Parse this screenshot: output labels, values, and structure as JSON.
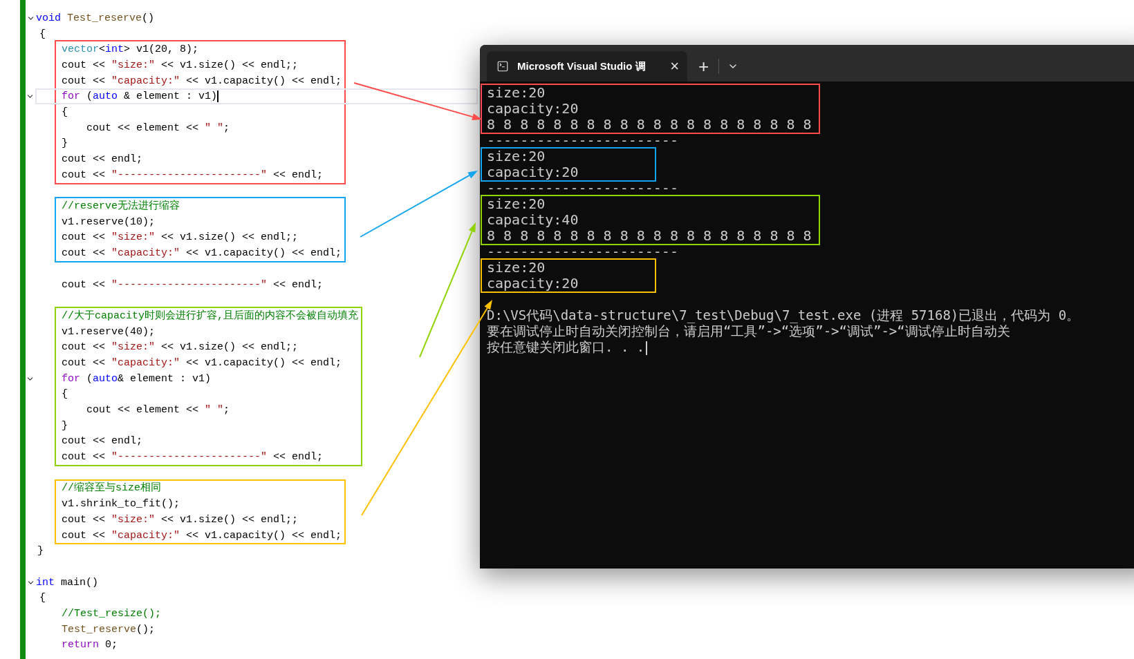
{
  "editor": {
    "functions": [
      {
        "header": {
          "expanded": true,
          "segments": [
            {
              "kind": "keyword",
              "text": "void"
            },
            {
              "kind": "function",
              "text": " Test_reserve"
            },
            {
              "kind": "plain",
              "text": "()"
            }
          ]
        },
        "open": "{",
        "blocks": [
          {
            "kind": "box",
            "color": "#ff4b4b",
            "lines": [
              {
                "segments": [
                  {
                    "kind": "type",
                    "text": "vector"
                  },
                  {
                    "kind": "plain",
                    "text": "<"
                  },
                  {
                    "kind": "keyword",
                    "text": "int"
                  },
                  {
                    "kind": "plain",
                    "text": "> v1(20, 8);"
                  }
                ]
              },
              {
                "segments": [
                  {
                    "kind": "plain",
                    "text": "cout << "
                  },
                  {
                    "kind": "string",
                    "text": "\"size:\""
                  },
                  {
                    "kind": "plain",
                    "text": " << v1.size() << endl;;"
                  }
                ]
              },
              {
                "segments": [
                  {
                    "kind": "plain",
                    "text": "cout << "
                  },
                  {
                    "kind": "string",
                    "text": "\"capacity:\""
                  },
                  {
                    "kind": "plain",
                    "text": " << v1.capacity() << endl;"
                  }
                ]
              },
              {
                "expanded": true,
                "current": true,
                "segments": [
                  {
                    "kind": "control",
                    "text": "for"
                  },
                  {
                    "kind": "plain",
                    "text": " ("
                  },
                  {
                    "kind": "keyword",
                    "text": "auto"
                  },
                  {
                    "kind": "plain",
                    "text": " & element : v1)"
                  }
                ]
              },
              {
                "segments": [
                  {
                    "kind": "plain",
                    "text": "{"
                  }
                ]
              },
              {
                "segments": [
                  {
                    "kind": "plain",
                    "text": "    cout << element << "
                  },
                  {
                    "kind": "string",
                    "text": "\" \""
                  },
                  {
                    "kind": "plain",
                    "text": ";"
                  }
                ]
              },
              {
                "segments": [
                  {
                    "kind": "plain",
                    "text": "}"
                  }
                ]
              },
              {
                "segments": [
                  {
                    "kind": "plain",
                    "text": "cout << endl;"
                  }
                ]
              },
              {
                "segments": [
                  {
                    "kind": "plain",
                    "text": "cout << "
                  },
                  {
                    "kind": "string",
                    "text": "\"-----------------------\""
                  },
                  {
                    "kind": "plain",
                    "text": " << endl;"
                  }
                ]
              }
            ]
          },
          {
            "kind": "box",
            "color": "#12a5f0",
            "lines": [
              {
                "segments": [
                  {
                    "kind": "comment",
                    "text": "//reserve无法进行缩容"
                  }
                ]
              },
              {
                "segments": [
                  {
                    "kind": "plain",
                    "text": "v1.reserve(10);"
                  }
                ]
              },
              {
                "segments": [
                  {
                    "kind": "plain",
                    "text": "cout << "
                  },
                  {
                    "kind": "string",
                    "text": "\"size:\""
                  },
                  {
                    "kind": "plain",
                    "text": " << v1.size() << endl;;"
                  }
                ]
              },
              {
                "segments": [
                  {
                    "kind": "plain",
                    "text": "cout << "
                  },
                  {
                    "kind": "string",
                    "text": "\"capacity:\""
                  },
                  {
                    "kind": "plain",
                    "text": " << v1.capacity() << endl;"
                  }
                ]
              }
            ]
          },
          {
            "kind": "plain",
            "lines": [
              {
                "segments": [
                  {
                    "kind": "plain",
                    "text": "cout << "
                  },
                  {
                    "kind": "string",
                    "text": "\"-----------------------\""
                  },
                  {
                    "kind": "plain",
                    "text": " << endl;"
                  }
                ]
              }
            ]
          },
          {
            "kind": "box",
            "color": "#8fd400",
            "lines": [
              {
                "segments": [
                  {
                    "kind": "comment",
                    "text": "//大于capacity时则会进行扩容,且后面的内容不会被自动填充"
                  }
                ]
              },
              {
                "segments": [
                  {
                    "kind": "plain",
                    "text": "v1.reserve(40);"
                  }
                ]
              },
              {
                "segments": [
                  {
                    "kind": "plain",
                    "text": "cout << "
                  },
                  {
                    "kind": "string",
                    "text": "\"size:\""
                  },
                  {
                    "kind": "plain",
                    "text": " << v1.size() << endl;;"
                  }
                ]
              },
              {
                "segments": [
                  {
                    "kind": "plain",
                    "text": "cout << "
                  },
                  {
                    "kind": "string",
                    "text": "\"capacity:\""
                  },
                  {
                    "kind": "plain",
                    "text": " << v1.capacity() << endl;"
                  }
                ]
              },
              {
                "expanded": true,
                "segments": [
                  {
                    "kind": "control",
                    "text": "for"
                  },
                  {
                    "kind": "plain",
                    "text": " ("
                  },
                  {
                    "kind": "keyword",
                    "text": "auto"
                  },
                  {
                    "kind": "plain",
                    "text": "& element : v1)"
                  }
                ]
              },
              {
                "segments": [
                  {
                    "kind": "plain",
                    "text": "{"
                  }
                ]
              },
              {
                "segments": [
                  {
                    "kind": "plain",
                    "text": "    cout << element << "
                  },
                  {
                    "kind": "string",
                    "text": "\" \""
                  },
                  {
                    "kind": "plain",
                    "text": ";"
                  }
                ]
              },
              {
                "segments": [
                  {
                    "kind": "plain",
                    "text": "}"
                  }
                ]
              },
              {
                "segments": [
                  {
                    "kind": "plain",
                    "text": "cout << endl;"
                  }
                ]
              },
              {
                "segments": [
                  {
                    "kind": "plain",
                    "text": "cout << "
                  },
                  {
                    "kind": "string",
                    "text": "\"-----------------------\""
                  },
                  {
                    "kind": "plain",
                    "text": " << endl;"
                  }
                ]
              }
            ]
          },
          {
            "kind": "box",
            "color": "#ffc000",
            "lines": [
              {
                "segments": [
                  {
                    "kind": "comment",
                    "text": "//缩容至与size相同"
                  }
                ]
              },
              {
                "segments": [
                  {
                    "kind": "plain",
                    "text": "v1.shrink_to_fit();"
                  }
                ]
              },
              {
                "segments": [
                  {
                    "kind": "plain",
                    "text": "cout << "
                  },
                  {
                    "kind": "string",
                    "text": "\"size:\""
                  },
                  {
                    "kind": "plain",
                    "text": " << v1.size() << endl;;"
                  }
                ]
              },
              {
                "segments": [
                  {
                    "kind": "plain",
                    "text": "cout << "
                  },
                  {
                    "kind": "string",
                    "text": "\"capacity:\""
                  },
                  {
                    "kind": "plain",
                    "text": " << v1.capacity() << endl;"
                  }
                ]
              }
            ]
          }
        ],
        "close": "}"
      },
      {
        "header": {
          "expanded": true,
          "segments": [
            {
              "kind": "keyword",
              "text": "int"
            },
            {
              "kind": "plain",
              "text": " main()"
            }
          ]
        },
        "open": "{",
        "blocks": [
          {
            "kind": "plain",
            "lines": [
              {
                "segments": [
                  {
                    "kind": "comment",
                    "text": "//Test_resize();"
                  }
                ]
              },
              {
                "segments": [
                  {
                    "kind": "function",
                    "text": "Test_reserve"
                  },
                  {
                    "kind": "plain",
                    "text": "();"
                  }
                ]
              },
              {
                "segments": [
                  {
                    "kind": "control",
                    "text": "return"
                  },
                  {
                    "kind": "plain",
                    "text": " 0;"
                  }
                ]
              }
            ]
          }
        ]
      }
    ]
  },
  "console": {
    "tab_title": "Microsoft Visual Studio 调",
    "tab_close": "×",
    "new_tab": "+",
    "output": [
      {
        "kind": "box",
        "color": "#ff4b4b",
        "lines": [
          "size:20",
          "capacity:20",
          "8 8 8 8 8 8 8 8 8 8 8 8 8 8 8 8 8 8 8 8"
        ]
      },
      {
        "kind": "text",
        "lines": [
          "-----------------------"
        ]
      },
      {
        "kind": "box",
        "color": "#12a5f0",
        "lines": [
          "size:20",
          "capacity:20"
        ]
      },
      {
        "kind": "text",
        "lines": [
          "-----------------------"
        ]
      },
      {
        "kind": "box",
        "color": "#8fd400",
        "lines": [
          "size:20",
          "capacity:40",
          "8 8 8 8 8 8 8 8 8 8 8 8 8 8 8 8 8 8 8 8"
        ]
      },
      {
        "kind": "text",
        "lines": [
          "-----------------------"
        ]
      },
      {
        "kind": "box",
        "color": "#ffc000",
        "lines": [
          "size:20",
          "capacity:20"
        ]
      },
      {
        "kind": "message",
        "lines": [
          "D:\\VS代码\\data-structure\\7_test\\Debug\\7_test.exe (进程 57168)已退出，代码为 0。",
          "要在调试停止时自动关闭控制台，请启用“工具”->“选项”->“调试”->“调试停止时自动关",
          "按任意键关闭此窗口. . ."
        ]
      }
    ]
  }
}
